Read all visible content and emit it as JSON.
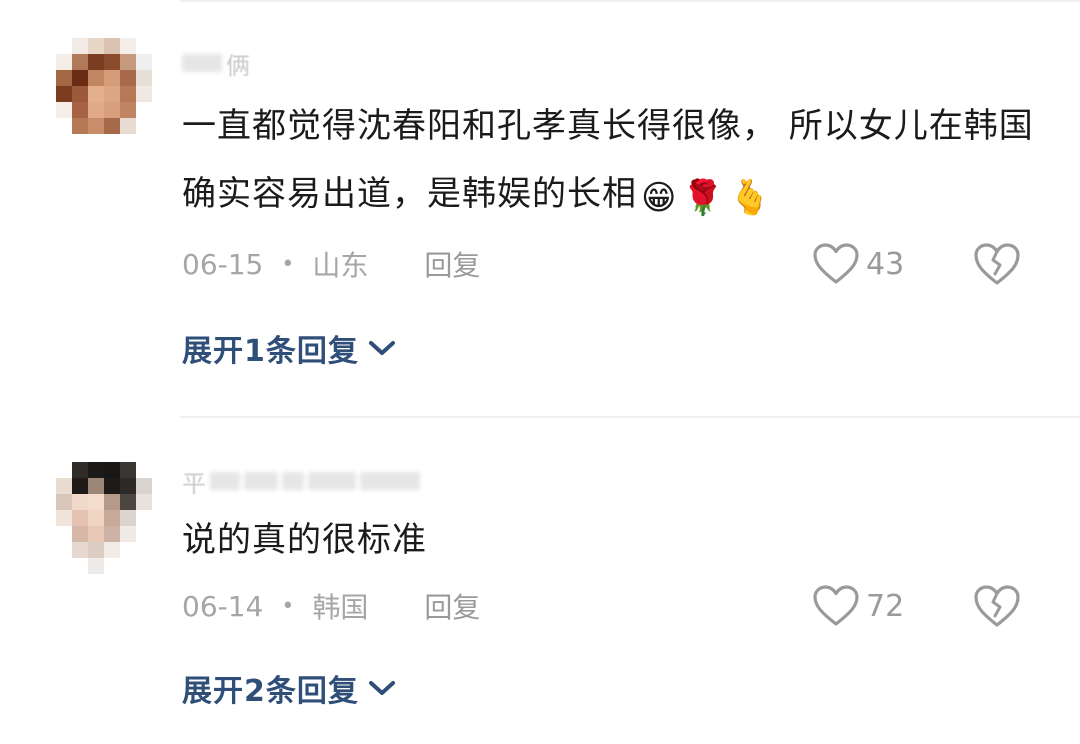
{
  "comments": [
    {
      "username_visible": "俩",
      "text": "一直都觉得沈春阳和孔孝真长得很像， 所以女儿在韩国确实容易出道，是韩娱的长相",
      "emojis": [
        "😁",
        "🌹",
        "🫰"
      ],
      "date": "06-15",
      "location": "山东",
      "reply_label": "回复",
      "likes": "43",
      "expand_label": "展开1条回复"
    },
    {
      "username_visible": "平",
      "text": "说的真的很标准",
      "emojis": [],
      "date": "06-14",
      "location": "韩国",
      "reply_label": "回复",
      "likes": "72",
      "expand_label": "展开2条回复"
    }
  ],
  "separator": "•",
  "colors": {
    "text": "#1b1b1b",
    "meta": "#a6a6a6",
    "expand_link": "#2f4f78",
    "icon": "#9a9a9a"
  }
}
